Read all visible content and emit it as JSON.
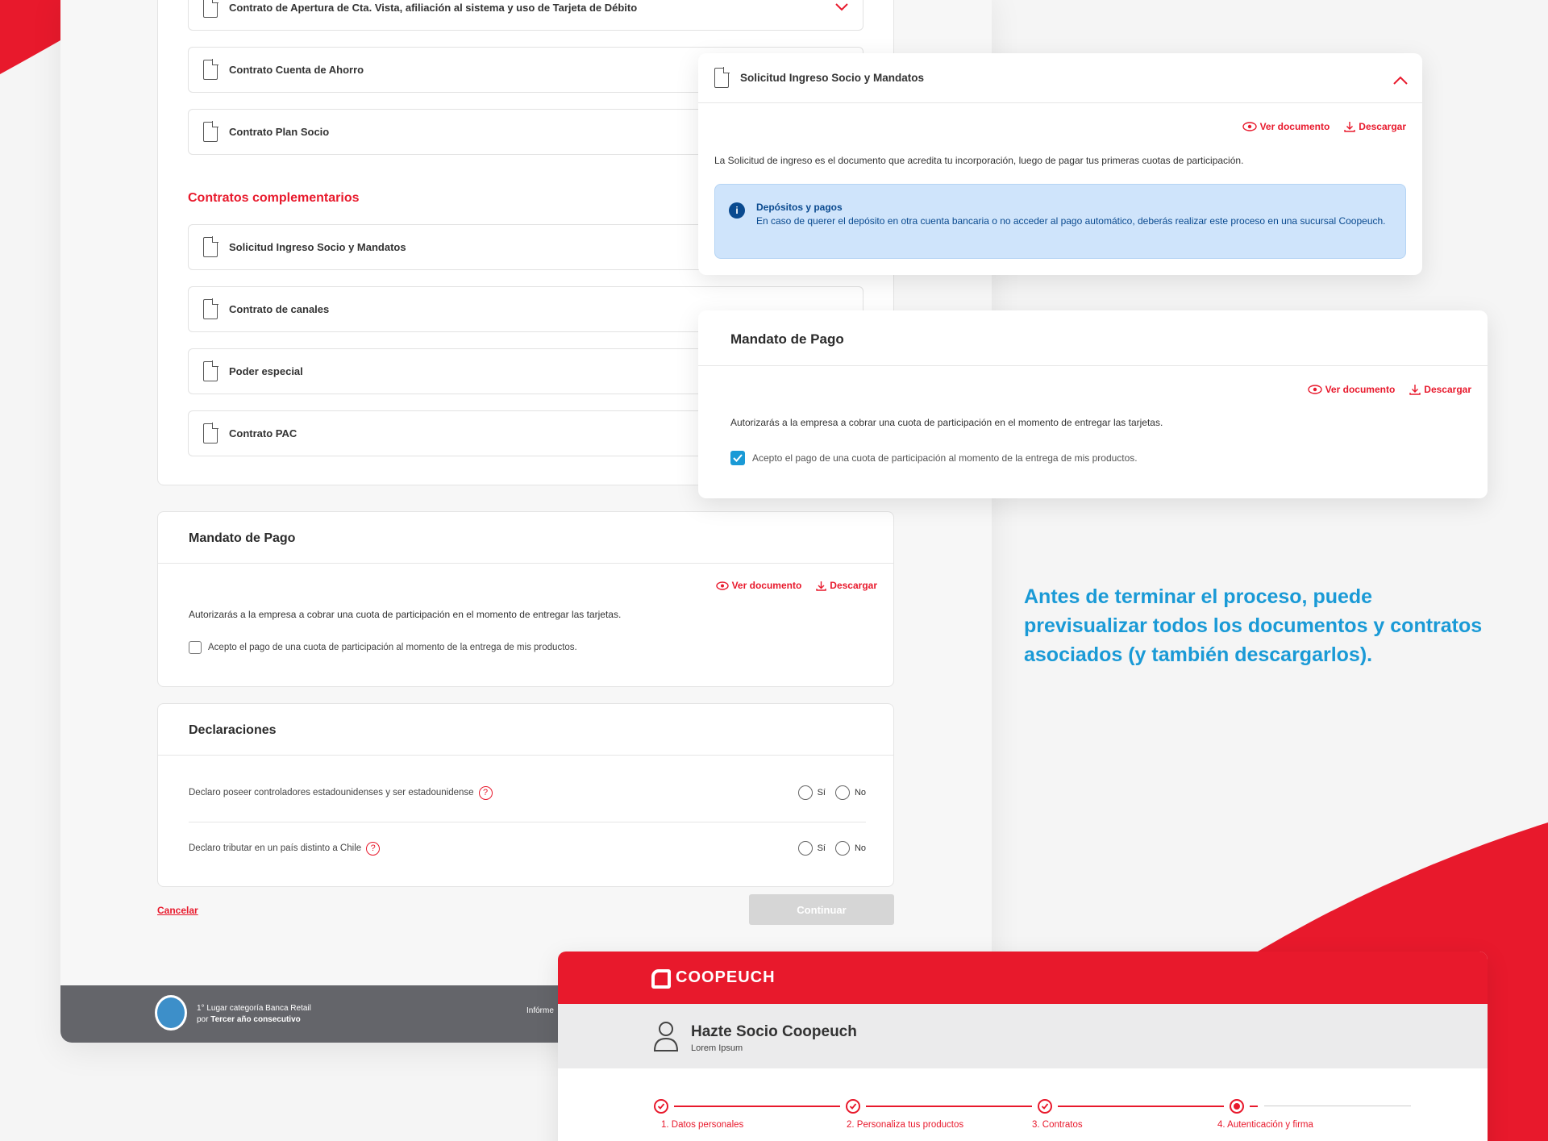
{
  "colors": {
    "brand_red": "#e8192c",
    "info_blue": "#1a9ad6",
    "dark_gray": "#64656a"
  },
  "documents": [
    {
      "label": "Contrato de Apertura de Cta. Vista, afiliación al sistema y uso de Tarjeta de Débito"
    },
    {
      "label": "Contrato Cuenta de Ahorro"
    },
    {
      "label": "Contrato Plan Socio"
    }
  ],
  "complementarios": {
    "title": "Contratos complementarios",
    "items": [
      {
        "label": "Solicitud  Ingreso Socio y Mandatos"
      },
      {
        "label": "Contrato de canales"
      },
      {
        "label": "Poder especial"
      },
      {
        "label": "Contrato PAC"
      }
    ]
  },
  "mandato": {
    "title": "Mandato de Pago",
    "ver": "Ver documento",
    "descargar": "Descargar",
    "text": "Autorizarás a la empresa a cobrar una cuota de participación en el momento de entregar las tarjetas.",
    "checkbox": "Acepto el pago de una cuota de participación al momento de la entrega de mis productos."
  },
  "declaraciones": {
    "title": "Declaraciones",
    "items": [
      {
        "text": "Declaro poseer controladores estadounidenses y ser estadounidense"
      },
      {
        "text": "Declaro tributar en un país distinto a Chile"
      }
    ],
    "si": "Sí",
    "no": "No"
  },
  "actions": {
    "cancel": "Cancelar",
    "continue": "Continuar"
  },
  "footer": {
    "line1": "1° Lugar categoría Banca Retail",
    "line2a": "por ",
    "line2b": "Tercer año consecutivo",
    "info": "Infórme"
  },
  "solicitud": {
    "title": "Solicitud Ingreso Socio y Mandatos",
    "ver": "Ver documento",
    "descargar": "Descargar",
    "text": "La Solicitud de ingreso es el documento que acredita tu incorporación, luego de pagar tus primeras cuotas de participación.",
    "info_title": "Depósitos y pagos",
    "info_text": "En caso de querer el depósito en otra cuenta bancaria o no acceder al pago automático, deberás realizar este proceso en una sucursal Coopeuch."
  },
  "mandato2": {
    "title": "Mandato de Pago",
    "ver": "Ver documento",
    "descargar": "Descargar",
    "text": "Autorizarás a la empresa a cobrar una cuota de participación en el momento de entregar las tarjetas.",
    "checkbox": "Acepto el pago de una cuota de participación al momento de la entrega de mis productos.",
    "checked": true
  },
  "tagline": "Antes de terminar el proceso, puede previsualizar todos los documentos y contratos asociados (y también descargarlos).",
  "coopeuch": {
    "brand": "COOPEUCH",
    "title": "Hazte Socio Coopeuch",
    "subtitle": "Lorem Ipsum",
    "steps": [
      "1. Datos personales",
      "2. Personaliza tus productos",
      "3. Contratos",
      "4. Autenticación y firma"
    ],
    "current_step": 4
  }
}
